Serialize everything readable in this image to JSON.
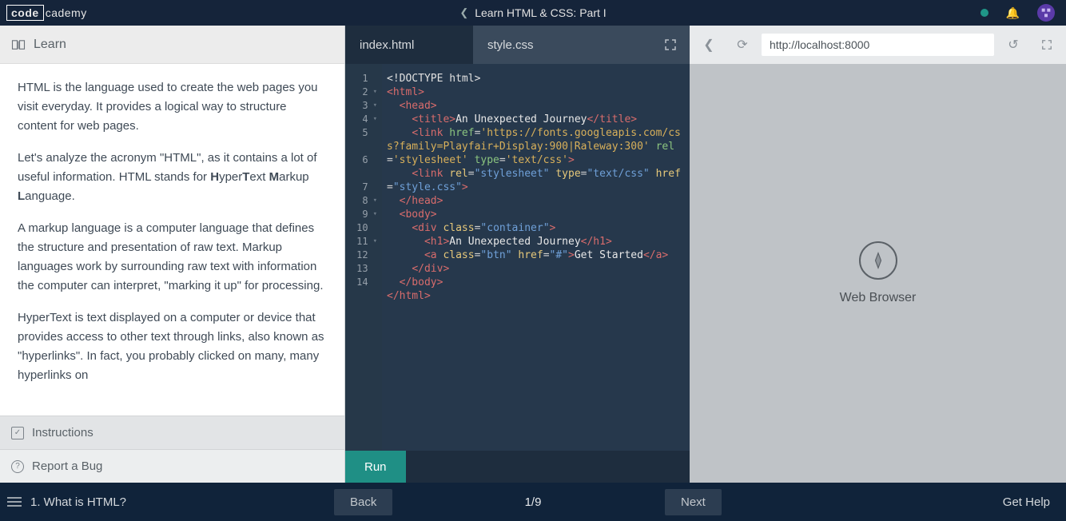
{
  "header": {
    "logo_left": "code",
    "logo_right": "cademy",
    "course_title": "Learn HTML & CSS: Part I"
  },
  "left_panel": {
    "learn_label": "Learn",
    "paragraphs": [
      "HTML is the language used to create the web pages you visit everyday. It provides a logical way to structure content for web pages.",
      "Let's analyze the acronym \"HTML\", as it contains a lot of useful information. HTML stands for HyperText Markup Language.",
      "A markup language is a computer language that defines the structure and presentation of raw text. Markup languages work by surrounding raw text with information the computer can interpret, \"marking it up\" for processing.",
      "HyperText is text displayed on a computer or device that provides access to other text through links, also known as \"hyperlinks\". In fact, you probably clicked on many, many hyperlinks on"
    ],
    "instructions_label": "Instructions",
    "bug_label": "Report a Bug"
  },
  "editor": {
    "tabs": [
      {
        "label": "index.html",
        "active": true
      },
      {
        "label": "style.css",
        "active": false
      }
    ],
    "run_label": "Run",
    "gutter": [
      "1",
      "2",
      "3",
      "4",
      "5",
      "",
      "6",
      "",
      "7",
      "8",
      "9",
      "10",
      "11",
      "12",
      "13",
      "14"
    ],
    "code_raw": "<!DOCTYPE html>\n<html>\n  <head>\n    <title>An Unexpected Journey</title>\n    <link href='https://fonts.googleapis.com/css?family=Playfair+Display:900|Raleway:300' rel='stylesheet' type='text/css'>\n    <link rel=\"stylesheet\" type=\"text/css\" href=\"style.css\">\n  </head>\n  <body>\n    <div class=\"container\">\n      <h1>An Unexpected Journey</h1>\n      <a class=\"btn\" href=\"#\">Get Started</a>\n    </div>\n  </body>\n</html>"
  },
  "browser": {
    "url": "http://localhost:8000",
    "placeholder_label": "Web Browser"
  },
  "footer": {
    "lesson_title": "1. What is HTML?",
    "back_label": "Back",
    "next_label": "Next",
    "pager": "1/9",
    "help_label": "Get Help"
  }
}
